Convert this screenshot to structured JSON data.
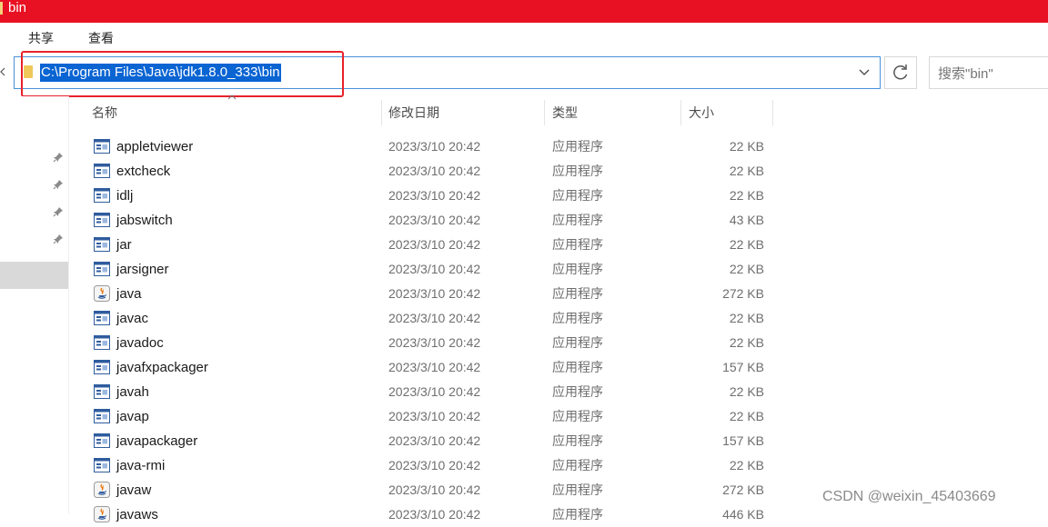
{
  "window": {
    "title": "bin"
  },
  "ribbon": {
    "tabs": [
      "共享",
      "查看"
    ]
  },
  "address_bar": {
    "path": "C:\\Program Files\\Java\\jdk1.8.0_333\\bin"
  },
  "search": {
    "placeholder": "搜索\"bin\""
  },
  "columns": {
    "name": "名称",
    "date": "修改日期",
    "type": "类型",
    "size": "大小"
  },
  "files": [
    {
      "name": "appletviewer",
      "date": "2023/3/10 20:42",
      "type": "应用程序",
      "size": "22 KB",
      "icon": "exe-icon"
    },
    {
      "name": "extcheck",
      "date": "2023/3/10 20:42",
      "type": "应用程序",
      "size": "22 KB",
      "icon": "exe-icon"
    },
    {
      "name": "idlj",
      "date": "2023/3/10 20:42",
      "type": "应用程序",
      "size": "22 KB",
      "icon": "exe-icon"
    },
    {
      "name": "jabswitch",
      "date": "2023/3/10 20:42",
      "type": "应用程序",
      "size": "43 KB",
      "icon": "exe-icon"
    },
    {
      "name": "jar",
      "date": "2023/3/10 20:42",
      "type": "应用程序",
      "size": "22 KB",
      "icon": "exe-icon"
    },
    {
      "name": "jarsigner",
      "date": "2023/3/10 20:42",
      "type": "应用程序",
      "size": "22 KB",
      "icon": "exe-icon"
    },
    {
      "name": "java",
      "date": "2023/3/10 20:42",
      "type": "应用程序",
      "size": "272 KB",
      "icon": "java-icon"
    },
    {
      "name": "javac",
      "date": "2023/3/10 20:42",
      "type": "应用程序",
      "size": "22 KB",
      "icon": "exe-icon"
    },
    {
      "name": "javadoc",
      "date": "2023/3/10 20:42",
      "type": "应用程序",
      "size": "22 KB",
      "icon": "exe-icon"
    },
    {
      "name": "javafxpackager",
      "date": "2023/3/10 20:42",
      "type": "应用程序",
      "size": "157 KB",
      "icon": "exe-icon"
    },
    {
      "name": "javah",
      "date": "2023/3/10 20:42",
      "type": "应用程序",
      "size": "22 KB",
      "icon": "exe-icon"
    },
    {
      "name": "javap",
      "date": "2023/3/10 20:42",
      "type": "应用程序",
      "size": "22 KB",
      "icon": "exe-icon"
    },
    {
      "name": "javapackager",
      "date": "2023/3/10 20:42",
      "type": "应用程序",
      "size": "157 KB",
      "icon": "exe-icon"
    },
    {
      "name": "java-rmi",
      "date": "2023/3/10 20:42",
      "type": "应用程序",
      "size": "22 KB",
      "icon": "exe-icon"
    },
    {
      "name": "javaw",
      "date": "2023/3/10 20:42",
      "type": "应用程序",
      "size": "272 KB",
      "icon": "java-icon"
    },
    {
      "name": "javaws",
      "date": "2023/3/10 20:42",
      "type": "应用程序",
      "size": "446 KB",
      "icon": "java-icon"
    }
  ],
  "watermark": "CSDN @weixin_45403669",
  "colors": {
    "titlebar": "#e81123",
    "highlight_box": "#e8212b",
    "selection": "#0a64d2"
  }
}
